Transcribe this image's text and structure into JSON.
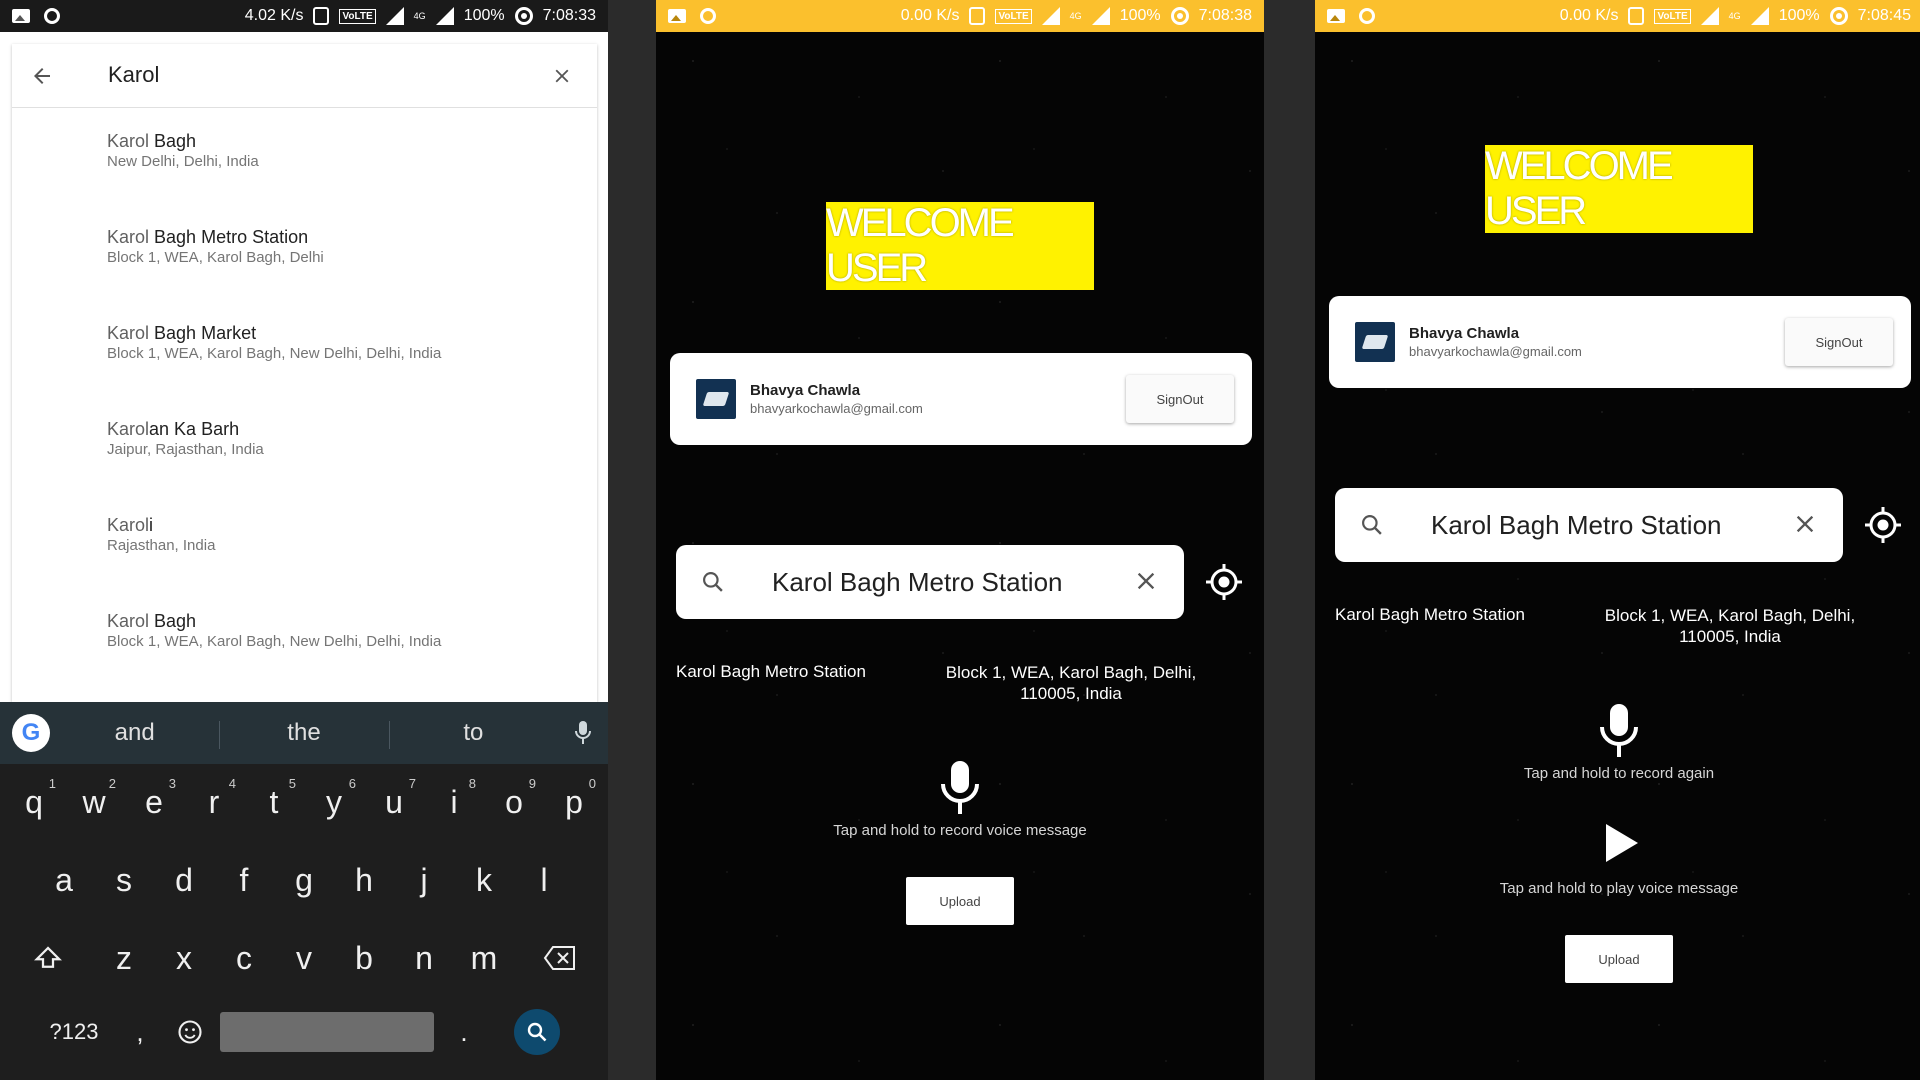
{
  "screen1": {
    "status": {
      "speed": "4.02 K/s",
      "volte": "VoLTE",
      "net": "4G",
      "battery": "100%",
      "time": "7:08:33"
    },
    "search": {
      "query": "Karol",
      "results": [
        {
          "match": "Karol",
          "rest": " Bagh",
          "sub": "New Delhi, Delhi, India"
        },
        {
          "match": "Karol",
          "rest": " Bagh Metro Station",
          "sub": "Block 1, WEA, Karol Bagh, Delhi"
        },
        {
          "match": "Karol",
          "rest": " Bagh Market",
          "sub": "Block 1, WEA, Karol Bagh, New Delhi, Delhi, India"
        },
        {
          "match": "Karol",
          "rest": "an Ka Barh",
          "sub": "Jaipur, Rajasthan, India"
        },
        {
          "match": "Karol",
          "rest": "i",
          "sub": "Rajasthan, India"
        },
        {
          "match": "Karol",
          "rest": " Bagh",
          "sub": "Block 1, WEA, Karol Bagh, New Delhi, Delhi, India"
        }
      ]
    },
    "keyboard": {
      "google_logo": "G",
      "suggestions": [
        "and",
        "the",
        "to"
      ],
      "row1": [
        "q",
        "w",
        "e",
        "r",
        "t",
        "y",
        "u",
        "i",
        "o",
        "p"
      ],
      "row1_hints": [
        "1",
        "2",
        "3",
        "4",
        "5",
        "6",
        "7",
        "8",
        "9",
        "0"
      ],
      "row2": [
        "a",
        "s",
        "d",
        "f",
        "g",
        "h",
        "j",
        "k",
        "l"
      ],
      "row3": [
        "z",
        "x",
        "c",
        "v",
        "b",
        "n",
        "m"
      ],
      "symbols": "?123",
      "comma": ",",
      "period": "."
    }
  },
  "screen2": {
    "status": {
      "speed": "0.00 K/s",
      "volte": "VoLTE",
      "net": "4G",
      "battery": "100%",
      "time": "7:08:38"
    },
    "welcome": "WELCOME USER",
    "user": {
      "name": "Bhavya Chawla",
      "email": "bhavyarkochawla@gmail.com",
      "signout": "SignOut"
    },
    "search_text": "Karol Bagh Metro Station",
    "place_name": "Karol Bagh Metro Station",
    "address_line1": "Block 1, WEA, Karol Bagh, Delhi,",
    "address_line2": "110005, India",
    "record_hint": "Tap and hold to record voice message",
    "upload": "Upload"
  },
  "screen3": {
    "status": {
      "speed": "0.00 K/s",
      "volte": "VoLTE",
      "net": "4G",
      "battery": "100%",
      "time": "7:08:45"
    },
    "welcome": "WELCOME USER",
    "user": {
      "name": "Bhavya Chawla",
      "email": "bhavyarkochawla@gmail.com",
      "signout": "SignOut"
    },
    "search_text": "Karol Bagh Metro Station",
    "place_name": "Karol Bagh Metro Station",
    "address_line1": "Block 1, WEA, Karol Bagh, Delhi,",
    "address_line2": "110005, India",
    "record_hint": "Tap and hold to record again",
    "play_hint": "Tap and hold to play voice message",
    "upload": "Upload"
  },
  "colors": {
    "status_yellow": "#fbc02d",
    "welcome_yellow": "#fff200",
    "enter_key": "#0e4a6e",
    "suggestion_bar": "#263238"
  },
  "icons": [
    "back-arrow-icon",
    "close-icon",
    "search-icon",
    "locate-icon",
    "mic-icon",
    "play-icon",
    "shift-icon",
    "backspace-icon",
    "emoji-icon"
  ]
}
